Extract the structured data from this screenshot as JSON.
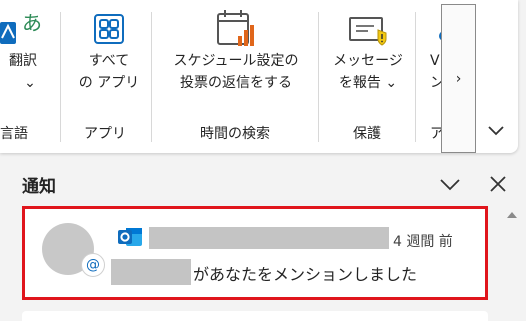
{
  "ribbon": {
    "groups": [
      {
        "label": "言語",
        "buttons": [
          {
            "label_lines": [
              "翻訳",
              "⌄"
            ]
          }
        ]
      },
      {
        "label": "アプリ",
        "buttons": [
          {
            "label_lines": [
              "すべて",
              "の アプリ"
            ]
          }
        ]
      },
      {
        "label": "時間の検索",
        "buttons": [
          {
            "label_lines": [
              "スケジュール設定の",
              "投票の返信をする"
            ]
          }
        ]
      },
      {
        "label": "保護",
        "buttons": [
          {
            "label_lines": [
              "メッセージ",
              "を報告 ⌄"
            ]
          }
        ]
      },
      {
        "label": "ア",
        "buttons": [
          {
            "label_lines": [
              "V",
              "ン"
            ]
          }
        ]
      }
    ],
    "scroll_right_label": "›",
    "collapse_label": "⌄"
  },
  "pane": {
    "title": "通知",
    "notification": {
      "time": "4 週間 前",
      "message": "があなたをメンションしました",
      "mention_symbol": "@"
    }
  },
  "colors": {
    "outlook_blue": "#0f6cbd",
    "highlight_red": "#e0151c",
    "redaction": "#c4c4c4"
  }
}
